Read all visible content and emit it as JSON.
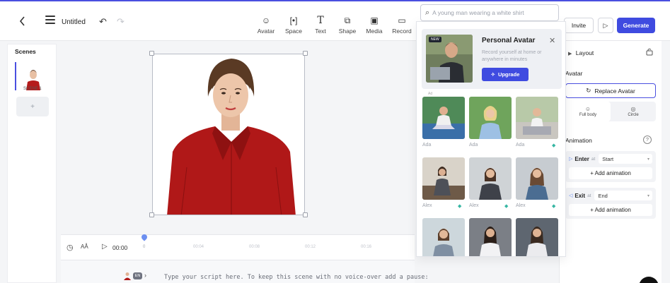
{
  "header": {
    "doc_title": "Untitled",
    "tools": [
      {
        "label": "Avatar",
        "icon": "avatar-icon"
      },
      {
        "label": "Space",
        "icon": "space-icon"
      },
      {
        "label": "Text",
        "icon": "text-icon"
      },
      {
        "label": "Shape",
        "icon": "shape-icon"
      },
      {
        "label": "Media",
        "icon": "media-icon"
      },
      {
        "label": "Record",
        "icon": "record-icon"
      }
    ],
    "invite_label": "Invite",
    "generate_label": "Generate",
    "accent_color": "#3f4be0"
  },
  "search": {
    "placeholder": "A young man wearing a white shirt"
  },
  "scenes": {
    "title": "Scenes",
    "items": [
      {
        "label": "SCENE 1"
      }
    ],
    "add_label": "+"
  },
  "timeline": {
    "time": "00:00",
    "start": "0",
    "ticks": [
      "00:04",
      "00:08",
      "00:12",
      "00:16"
    ],
    "aa_label": "AÅ"
  },
  "script": {
    "badge": "EN",
    "placeholder": "Type your script here. To keep this scene with no voice-over add a pause:"
  },
  "avatar_panel": {
    "personal": {
      "badge": "NEW",
      "title": "Personal Avatar",
      "description": "Record yourself at home or anywhere in minutes",
      "upgrade_label": "Upgrade",
      "cut_label": "Ad"
    },
    "avatars": [
      {
        "name": "Ada",
        "premium": false
      },
      {
        "name": "Ada",
        "premium": false
      },
      {
        "name": "Ada",
        "premium": true
      },
      {
        "name": "Alex",
        "premium": true
      },
      {
        "name": "Alex",
        "premium": true
      },
      {
        "name": "Alex",
        "premium": true
      },
      {
        "name": "",
        "premium": false
      },
      {
        "name": "",
        "premium": false
      },
      {
        "name": "",
        "premium": false
      }
    ]
  },
  "properties": {
    "layout_label": "Layout",
    "avatar_label": "Avatar",
    "replace_label": "Replace Avatar",
    "shape_options": [
      {
        "label": "Full body",
        "active": true
      },
      {
        "label": "Circle",
        "active": false
      }
    ],
    "animation_label": "Animation",
    "enter": {
      "label": "Enter",
      "at": "at",
      "value": "Start",
      "add_label": "+ Add animation"
    },
    "exit": {
      "label": "Exit",
      "at": "at",
      "value": "End",
      "add_label": "+ Add animation"
    }
  }
}
